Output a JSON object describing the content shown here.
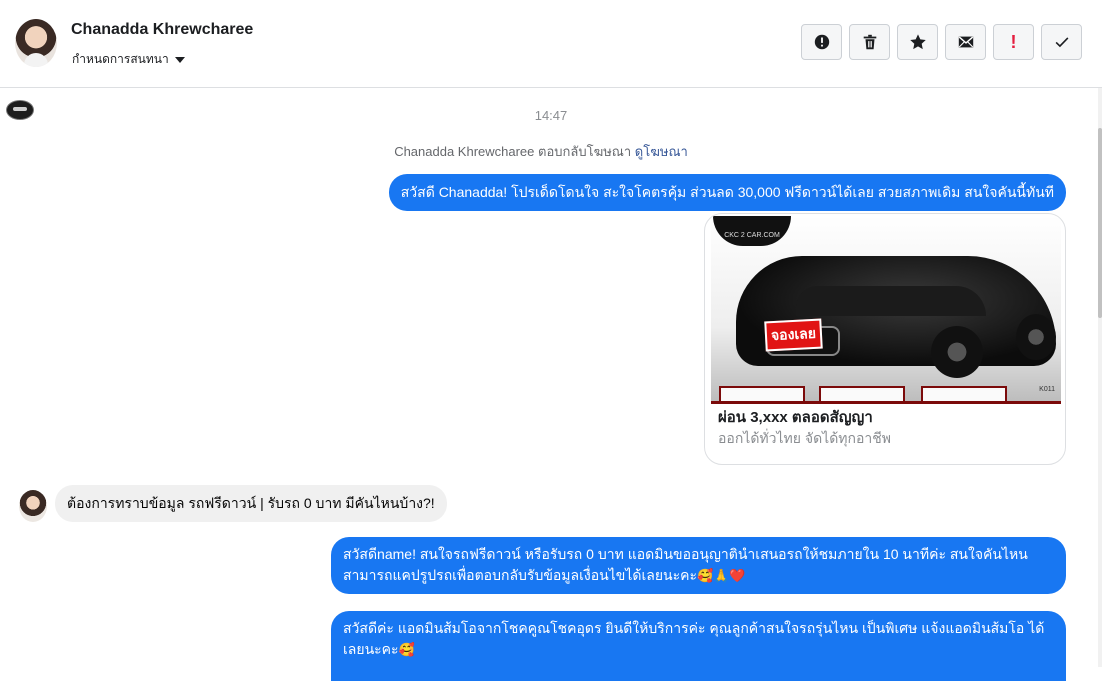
{
  "header": {
    "contact_name": "Chanadda Khrewcharee",
    "conversation_settings_label": "กำหนดการสนทนา",
    "actions": [
      {
        "name": "mark-spam-button",
        "icon": "alert-circle-icon"
      },
      {
        "name": "delete-button",
        "icon": "trash-icon"
      },
      {
        "name": "star-button",
        "icon": "star-icon"
      },
      {
        "name": "mark-unread-button",
        "icon": "envelope-icon"
      },
      {
        "name": "follow-up-button",
        "icon": "exclamation-icon",
        "label": "!"
      },
      {
        "name": "mark-done-button",
        "icon": "check-icon"
      }
    ]
  },
  "thread": {
    "timestamp": "14:47",
    "ad_reply_text": "Chanadda Khrewcharee ตอบกลับโฆษณา",
    "ad_reply_link": "ดูโฆษณา",
    "messages": [
      {
        "direction": "outgoing",
        "text": "สวัสดี Chanadda! โปรเด็ดโดนใจ สะใจโคตรคุ้ม ส่วนลด 30,000 ฟรีดาวน์ได้เลย สวยสภาพเดิม สนใจคันนี้ทันที"
      },
      {
        "direction": "outgoing",
        "type": "ad_card",
        "card_logo": "CKC 2 CAR.COM",
        "card_badge": "จองเลย",
        "card_code": "K011",
        "card_title": "ผ่อน 3,xxx ตลอดสัญญา",
        "card_subtitle": "ออกได้ทั่วไทย จัดได้ทุกอาชีพ"
      },
      {
        "direction": "incoming",
        "text": "ต้องการทราบข้อมูล รถฟรีดาวน์ | รับรถ 0 บาท มีคันไหนบ้าง?!"
      },
      {
        "direction": "outgoing",
        "text": "สวัสดีname! สนใจรถฟรีดาวน์ หรือรับรถ 0 บาท แอดมินขออนุญาตินำเสนอรถให้ชมภายใน 10 นาทีค่ะ สนใจคันไหนสามารถแคปรูปรถเพื่อตอบกลับรับข้อมูลเงื่อนไขได้เลยนะคะ",
        "emojis": [
          "🥰",
          "🙏",
          "❤️"
        ]
      },
      {
        "direction": "outgoing",
        "text": "สวัสดีค่ะ แอดมินส้มโอจากโชคคูณโชคอุดร ยินดีให้บริการค่ะ   คุณลูกค้าสนใจรถรุ่นไหน เป็นพิเศษ แจ้งแอดมินส้มโอ ได้เลยนะคะ",
        "emojis": [
          "🥰"
        ]
      }
    ]
  },
  "colors": {
    "outgoing_bubble": "#1877f2",
    "incoming_bubble": "#f0f0f0",
    "link": "#385898",
    "follow_up_red": "#e41e3f"
  }
}
